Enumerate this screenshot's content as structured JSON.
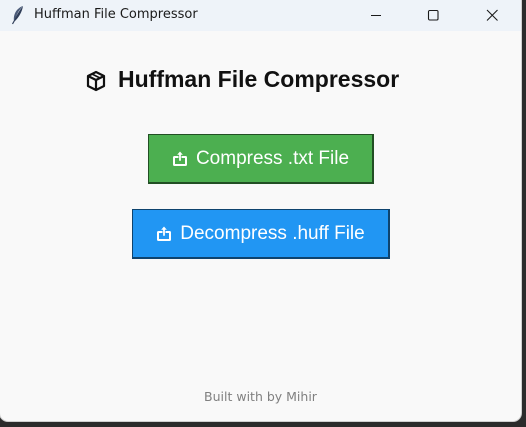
{
  "window": {
    "title": "Huffman File Compressor",
    "app_icon": "feather-icon",
    "controls": {
      "minimize": "minimize-icon",
      "maximize": "maximize-icon",
      "close": "close-icon"
    }
  },
  "main": {
    "heading_icon": "package-icon",
    "heading": "Huffman File Compressor",
    "buttons": {
      "compress_label": "Compress .txt File",
      "compress_icon": "upload-tray-icon",
      "compress_color": "#4caf50",
      "decompress_label": "Decompress .huff File",
      "decompress_icon": "upload-tray-icon",
      "decompress_color": "#2196f3"
    }
  },
  "footer": {
    "text": "Built with by Mihir"
  }
}
